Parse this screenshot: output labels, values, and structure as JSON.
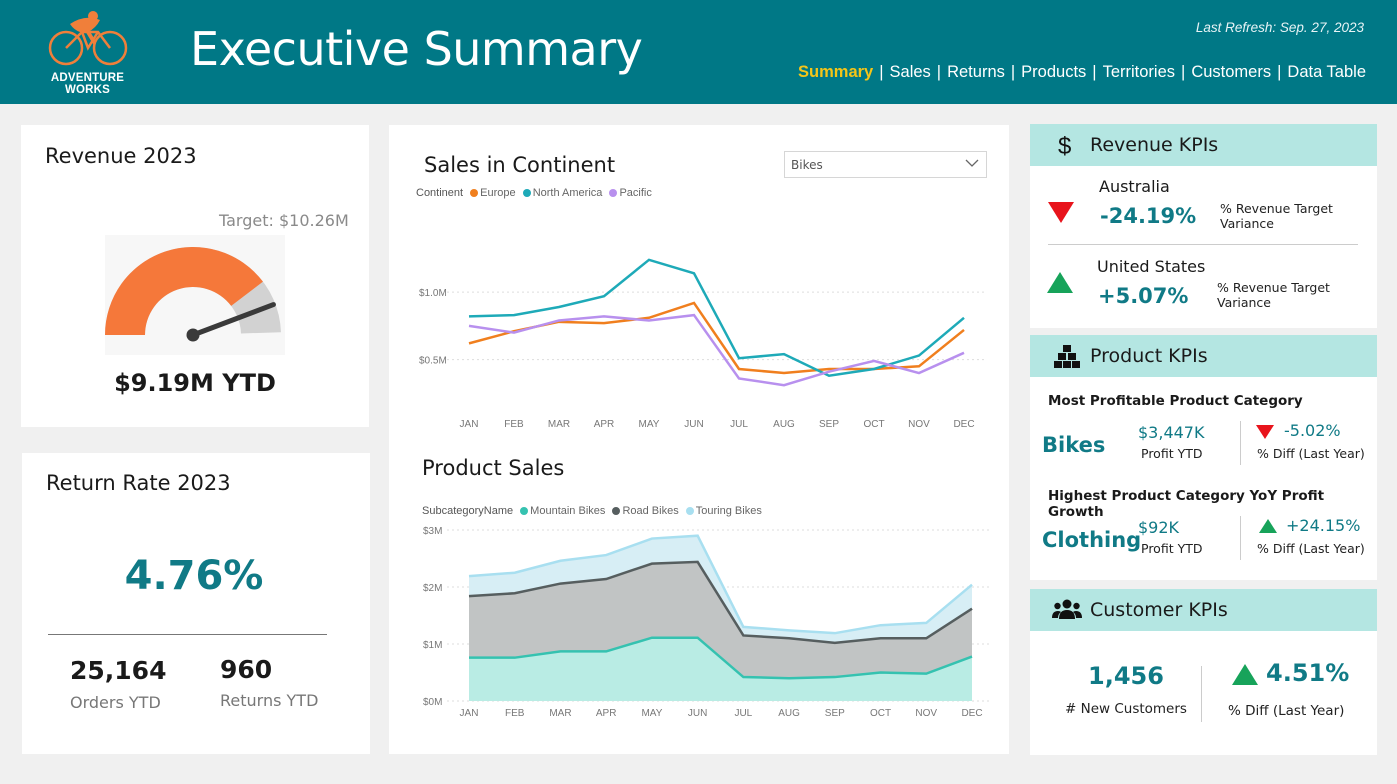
{
  "header": {
    "logo_text": "ADVENTURE WORKS",
    "title": "Executive Summary",
    "last_refresh": "Last Refresh: Sep. 27, 2023",
    "nav": [
      "Summary",
      "Sales",
      "Returns",
      "Products",
      "Territories",
      "Customers",
      "Data Table"
    ],
    "nav_active": "Summary",
    "nav_separator": "|"
  },
  "revenue": {
    "title": "Revenue 2023",
    "target_label": "Target: $10.26M",
    "ytd_label": "$9.19M YTD",
    "value_millions": 9.19,
    "target_millions": 10.26
  },
  "returns": {
    "title": "Return Rate 2023",
    "rate": "4.76%",
    "orders_value": "25,164",
    "orders_label": "Orders YTD",
    "returns_value": "960",
    "returns_label": "Returns YTD"
  },
  "sales_continent": {
    "title": "Sales in Continent",
    "filter_value": "Bikes",
    "legend_title": "Continent",
    "chart_data": {
      "type": "line",
      "categories": [
        "JAN",
        "FEB",
        "MAR",
        "APR",
        "MAY",
        "JUN",
        "JUL",
        "AUG",
        "SEP",
        "OCT",
        "NOV",
        "DEC"
      ],
      "series": [
        {
          "name": "Europe",
          "color": "#f07f1e",
          "values": [
            0.62,
            0.71,
            0.78,
            0.77,
            0.81,
            0.92,
            0.43,
            0.4,
            0.43,
            0.43,
            0.45,
            0.72
          ]
        },
        {
          "name": "North America",
          "color": "#1eaab8",
          "values": [
            0.82,
            0.83,
            0.89,
            0.97,
            1.24,
            1.14,
            0.51,
            0.54,
            0.38,
            0.43,
            0.53,
            0.81
          ]
        },
        {
          "name": "Pacific",
          "color": "#b890ee",
          "values": [
            0.75,
            0.7,
            0.79,
            0.82,
            0.79,
            0.83,
            0.36,
            0.31,
            0.41,
            0.49,
            0.4,
            0.55
          ]
        }
      ],
      "y_ticks": [
        "$1.0M",
        "$0.5M"
      ],
      "y_tick_values": [
        1.0,
        0.5
      ],
      "ylim": [
        0.2,
        1.35
      ]
    }
  },
  "product_sales": {
    "title": "Product Sales",
    "legend_title": "SubcategoryName",
    "chart_data": {
      "type": "area",
      "stacked": true,
      "categories": [
        "JAN",
        "FEB",
        "MAR",
        "APR",
        "MAY",
        "JUN",
        "JUL",
        "AUG",
        "SEP",
        "OCT",
        "NOV",
        "DEC"
      ],
      "series": [
        {
          "name": "Mountain Bikes",
          "color": "#35c2b0",
          "values": [
            0.76,
            0.76,
            0.87,
            0.87,
            1.11,
            1.11,
            0.42,
            0.4,
            0.42,
            0.5,
            0.48,
            0.78
          ]
        },
        {
          "name": "Road Bikes",
          "color": "#565e5f",
          "values": [
            1.08,
            1.13,
            1.19,
            1.27,
            1.3,
            1.33,
            0.73,
            0.7,
            0.6,
            0.6,
            0.62,
            0.84
          ]
        },
        {
          "name": "Touring Bikes",
          "color": "#a8dff0",
          "values": [
            0.35,
            0.36,
            0.4,
            0.42,
            0.44,
            0.46,
            0.15,
            0.14,
            0.17,
            0.23,
            0.27,
            0.42
          ]
        }
      ],
      "y_ticks": [
        "$3M",
        "$2M",
        "$1M",
        "$0M"
      ],
      "y_tick_values": [
        3,
        2,
        1,
        0
      ],
      "ylim": [
        0,
        3
      ]
    }
  },
  "revenue_kpis": {
    "title": "Revenue KPIs",
    "items": [
      {
        "country": "Australia",
        "value": "-24.19%",
        "direction": "down",
        "label_line1": "% Revenue Target",
        "label_line2": "Variance"
      },
      {
        "country": "United States",
        "value": "+5.07%",
        "direction": "up",
        "label_line1": "% Revenue Target",
        "label_line2": "Variance"
      }
    ]
  },
  "product_kpis": {
    "title": "Product KPIs",
    "most_profitable": {
      "heading": "Most Profitable Product Category",
      "category": "Bikes",
      "profit": "$3,447K",
      "profit_label": "Profit YTD",
      "diff": "-5.02%",
      "direction": "down",
      "diff_label": "% Diff (Last Year)"
    },
    "highest_growth": {
      "heading": "Highest Product Category YoY Profit Growth",
      "category": "Clothing",
      "profit": "$92K",
      "profit_label": "Profit YTD",
      "diff": "+24.15%",
      "direction": "up",
      "diff_label": "% Diff (Last Year)"
    }
  },
  "customer_kpis": {
    "title": "Customer KPIs",
    "new_customers": "1,456",
    "new_customers_label": "# New Customers",
    "diff": "4.51%",
    "direction": "up",
    "diff_label": "% Diff (Last Year)"
  },
  "colors": {
    "header_bg": "#007886",
    "accent_teal": "#107a86",
    "nav_active": "#f5c518",
    "kpi_header_bg": "#b4e6e2",
    "gauge_fill": "#f5783a",
    "gauge_track": "#d2d2d2",
    "down": "#e8141c",
    "up": "#17a35a"
  }
}
